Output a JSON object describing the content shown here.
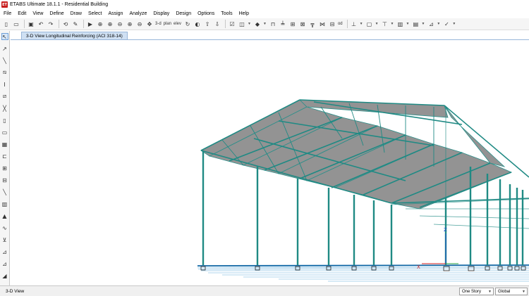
{
  "window": {
    "title": "ETABS Ultimate 18.1.1 - Residential Building",
    "logo_text": "ET"
  },
  "menu": [
    "File",
    "Edit",
    "View",
    "Define",
    "Draw",
    "Select",
    "Assign",
    "Analyze",
    "Display",
    "Design",
    "Options",
    "Tools",
    "Help"
  ],
  "toolbar": {
    "view_3d_label": "3-d",
    "plan_label": "plan",
    "elev_label": "elev",
    "disabled_label": "od"
  },
  "tab": {
    "label": "3-D View  Longitudinal Reinforcing  (ACI 318-14)"
  },
  "axes": {
    "x": "X",
    "z": "Z"
  },
  "status": {
    "left": "3-D View",
    "story_select": "One Story",
    "coord_select": "Global"
  },
  "colors": {
    "frame": "#1f8a84",
    "roof": "#8a8a8a",
    "base": "#2c8fd0"
  },
  "icons": [
    "pointer-icon",
    "reshape-icon",
    "draw-line-icon",
    "draw-beam-icon",
    "draw-column-icon",
    "draw-brace-icon",
    "draw-wall-icon",
    "draw-slab-icon",
    "draw-area-icon",
    "draw-opening-icon",
    "draw-null-icon",
    "draw-link-icon",
    "draw-grid-icon",
    "draw-section-cut-icon",
    "draw-spring-icon",
    "draw-point-icon",
    "draw-dimension-icon",
    "draw-reference-icon"
  ]
}
